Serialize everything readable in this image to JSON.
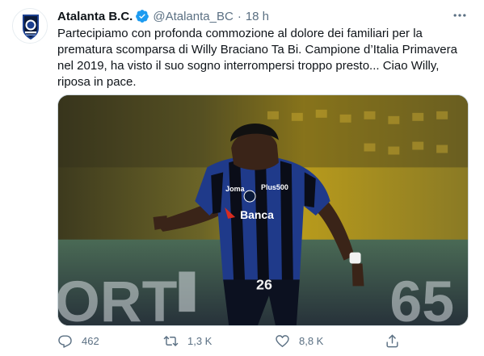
{
  "account": {
    "display_name": "Atalanta B.C.",
    "handle": "@Atalanta_BC",
    "separator": "·",
    "time": "18 h",
    "verified": true
  },
  "tweet": {
    "text": "Partecipiamo con profonda commozione al dolore dei familiari per la prematura scomparsa di Willy Braciano Ta Bi. Campione d’Italia Primavera nel 2019, ha visto il suo sogno interrompersi troppo presto... Ciao Willy, riposa in pace."
  },
  "media": {
    "jersey": {
      "brand": "Joma",
      "sponsor_top": "Plus500",
      "sponsor_main": "Banca",
      "number": "26"
    },
    "background_text": {
      "left": "ORT",
      "right": "65"
    }
  },
  "actions": {
    "reply_count": "462",
    "retweet_count": "1,3 K",
    "like_count": "8,8 K"
  },
  "icons": {
    "avatar": "atalanta-crest-icon",
    "verified": "verified-badge-icon",
    "more": "more-dots-icon",
    "reply": "reply-icon",
    "retweet": "retweet-icon",
    "like": "heart-icon",
    "share": "share-icon"
  },
  "colors": {
    "brand_blue": "#1d9bf0",
    "secondary_text": "#5b7083",
    "text": "#0f1419"
  }
}
